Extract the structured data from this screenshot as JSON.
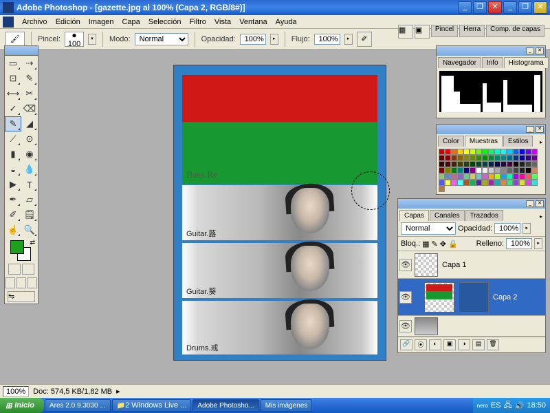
{
  "title": "Adobe Photoshop - [gazette.jpg al 100% (Capa 2, RGB/8#)]",
  "menus": [
    "Archivo",
    "Edición",
    "Imagen",
    "Capa",
    "Selección",
    "Filtro",
    "Vista",
    "Ventana",
    "Ayuda"
  ],
  "options": {
    "pincel_label": "Pincel:",
    "brush_size": "100",
    "modo_label": "Modo:",
    "modo_value": "Normal",
    "opacidad_label": "Opacidad:",
    "opacidad_value": "100%",
    "flujo_label": "Flujo:",
    "flujo_value": "100%"
  },
  "well_tabs": [
    "Pincel",
    "Herra",
    "Comp. de capas"
  ],
  "tools": [
    [
      "▭",
      "⇢"
    ],
    [
      "⊡",
      "✎"
    ],
    [
      "⟷",
      "✂"
    ],
    [
      "✓",
      "⌫"
    ],
    [
      "✎",
      "◢"
    ],
    [
      "⟋",
      "⊙"
    ],
    [
      "▮",
      "◉"
    ],
    [
      "◒",
      "💧"
    ],
    [
      "▶",
      "T"
    ],
    [
      "✒",
      "▱"
    ],
    [
      "✐",
      "🗒"
    ],
    [
      "☝",
      "🔍"
    ]
  ],
  "fg_color": "#1aa01a",
  "bg_color": "#ffffff",
  "canvas_labels": {
    "bass": "Bass.Re",
    "g1": "Guitar.蕗",
    "g2": "Guitar.葵",
    "drums": "Drums.戒"
  },
  "panels": {
    "nav_tabs": [
      "Navegador",
      "Info",
      "Histograma"
    ],
    "color_tabs": [
      "Color",
      "Muestras",
      "Estilos"
    ],
    "layers_tabs": [
      "Capas",
      "Canales",
      "Trazados"
    ]
  },
  "swatches": [
    "#c00",
    "#f00",
    "#f60",
    "#fc0",
    "#ff0",
    "#cf0",
    "#6f0",
    "#0f0",
    "#0f6",
    "#0fc",
    "#0ff",
    "#0cf",
    "#06f",
    "#00f",
    "#60f",
    "#c0f",
    "#600",
    "#800",
    "#830",
    "#860",
    "#880",
    "#680",
    "#380",
    "#080",
    "#083",
    "#086",
    "#088",
    "#068",
    "#038",
    "#008",
    "#308",
    "#608",
    "#300",
    "#400",
    "#420",
    "#440",
    "#240",
    "#040",
    "#042",
    "#044",
    "#024",
    "#004",
    "#204",
    "#404",
    "#000",
    "#222",
    "#444",
    "#666",
    "#800000",
    "#808000",
    "#008000",
    "#008080",
    "#000080",
    "#800080",
    "#fff",
    "#eee",
    "#ccc",
    "#aaa",
    "#888",
    "#666",
    "#444",
    "#222",
    "#000",
    "#c86",
    "#8c6",
    "#68c",
    "#c68",
    "#86c",
    "#6c8",
    "#cc6",
    "#6cc",
    "#c6c",
    "#fa0",
    "#af0",
    "#0af",
    "#0fa",
    "#a0f",
    "#f0a",
    "#f55",
    "#5f5",
    "#55f",
    "#ff5",
    "#f5f",
    "#5ff",
    "#a52",
    "#2a5",
    "#52a",
    "#aa2",
    "#a2a",
    "#2aa",
    "#d84",
    "#4d8",
    "#84d",
    "#dd4",
    "#d4d",
    "#4dd",
    "#b73"
  ],
  "layers": {
    "blend": "Normal",
    "opac_label": "Opacidad:",
    "opac_value": "100%",
    "bloq_label": "Bloq.:",
    "rell_label": "Relleno:",
    "rell_value": "100%",
    "items": [
      {
        "name": "Capa 1"
      },
      {
        "name": "Capa 2"
      }
    ]
  },
  "status": {
    "zoom": "100%",
    "doc_label": "Doc:",
    "doc": "574,5 KB/1,82 MB"
  },
  "taskbar": {
    "start": "Inicio",
    "tasks": [
      "Ares 2.0.9.3030 ...",
      "2 Windows Live ...",
      "Adobe Photosho...",
      "Mis imágenes"
    ],
    "lang": "ES",
    "time": "18:50"
  }
}
